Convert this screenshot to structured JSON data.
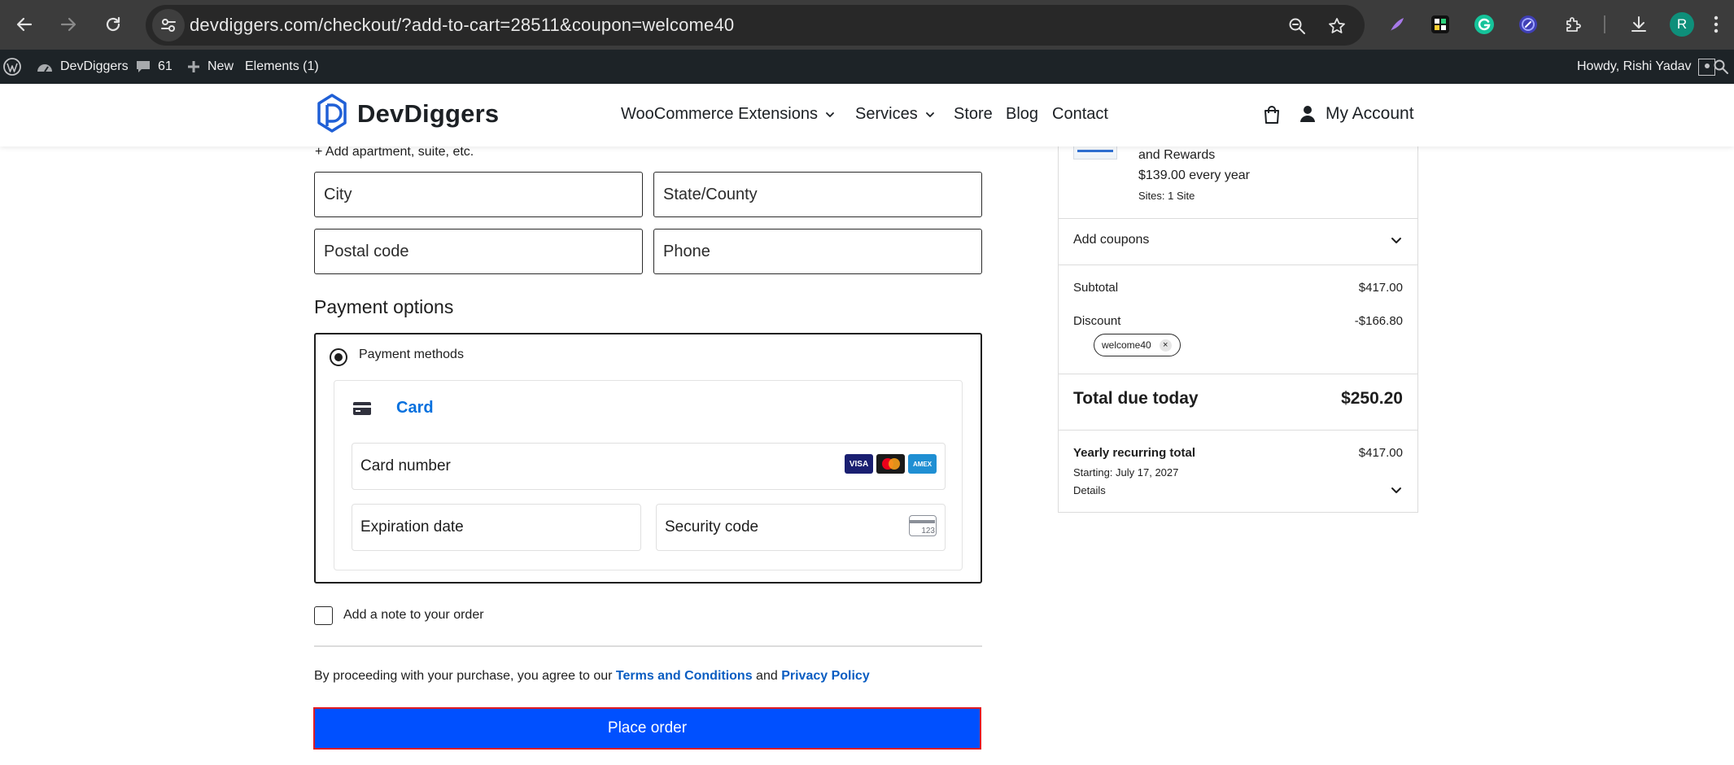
{
  "browser": {
    "url": "devdiggers.com/checkout/?add-to-cart=28511&coupon=welcome40",
    "profile_initial": "R"
  },
  "adminbar": {
    "site_name": "DevDiggers",
    "comments_count": "61",
    "new_label": "New",
    "elements_label": "Elements (1)",
    "howdy": "Howdy, Rishi Yadav"
  },
  "header": {
    "logo_text": "DevDiggers",
    "menu": [
      {
        "label": "WooCommerce Extensions"
      },
      {
        "label": "Services"
      },
      {
        "label": "Store"
      },
      {
        "label": "Blog"
      },
      {
        "label": "Contact"
      }
    ],
    "account_label": "My Account"
  },
  "form": {
    "add_apartment": "+ Add apartment, suite, etc.",
    "city": "City",
    "state": "State/County",
    "postal": "Postal code",
    "phone": "Phone",
    "payment_title": "Payment options",
    "payment_methods_label": "Payment methods",
    "card_tab": "Card",
    "card_number": "Card number",
    "expiration": "Expiration date",
    "security": "Security code",
    "cvc_hint": "123",
    "brands": [
      "VISA",
      "AMEX"
    ],
    "note_label": "Add a note to your order",
    "terms_prefix": "By proceeding with your purchase, you agree to our ",
    "terms_link": "Terms and Conditions",
    "terms_and": " and ",
    "privacy_link": "Privacy Policy",
    "place_order": "Place order"
  },
  "summary": {
    "product_name_tail": "and Rewards",
    "product_price": "$139.00 every year",
    "product_sites": "Sites: 1 Site",
    "add_coupons": "Add coupons",
    "subtotal_label": "Subtotal",
    "subtotal_value": "$417.00",
    "discount_label": "Discount",
    "discount_value": "-$166.80",
    "coupon_code": "welcome40",
    "total_label": "Total due today",
    "total_value": "$250.20",
    "recurring_label": "Yearly recurring total",
    "recurring_value": "$417.00",
    "starting": "Starting: July 17, 2027",
    "details": "Details"
  }
}
